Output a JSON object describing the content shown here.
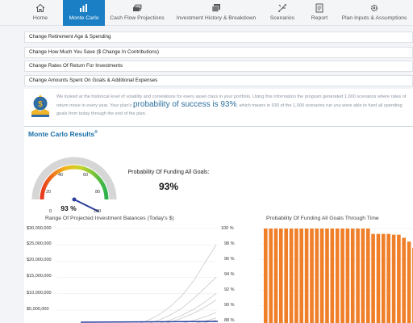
{
  "nav": {
    "items": [
      {
        "label": "Home",
        "icon": "home-icon"
      },
      {
        "label": "Monte Carlo",
        "icon": "bar-chart-icon",
        "active": true
      },
      {
        "label": "Cash Flow Projections",
        "icon": "cash-stack-icon"
      },
      {
        "label": "Investment History & Breakdown",
        "icon": "layers-icon"
      },
      {
        "label": "Scenarios",
        "icon": "scenarios-icon"
      },
      {
        "label": "Report",
        "icon": "report-icon"
      },
      {
        "label": "Plan Inputs & Assumptions",
        "icon": "gear-icon"
      }
    ]
  },
  "accordion": [
    "Change Retirement Age & Spending",
    "Change How Much You Save ($ Change In Contributions)",
    "Change Rates Of Return For Investments",
    "Change Amounts Spent On Goals & Additional Expenses"
  ],
  "intro": {
    "text_before": "We looked at the historical level of volatility and correlations for every asset class in your portfolio. Using this information the program generated 1,000 scenarios where rates of return move in every year. Your plan's ",
    "probability_phrase": "probability of success is 93%",
    "text_after": ", which means in 930 of the 1,000 scenarios run you were able to fund all spending goals from today through the end of the plan."
  },
  "results": {
    "title": "Monte Carlo Results",
    "registered": "®",
    "gauge": {
      "value": 93,
      "value_label": "93 %",
      "ticks": [
        "0",
        "20",
        "40",
        "60",
        "80",
        "100"
      ]
    },
    "funding_label": "Probability Of Funding All Goals:",
    "funding_value": "93%"
  },
  "colors": {
    "accent": "#1a7fc4",
    "bar": "#f07f2a",
    "gauge_needle": "#2a3f9e"
  },
  "chart_data": [
    {
      "type": "line",
      "title": "Range Of Projected Investment Balances (Today's $)",
      "y_tick_labels": [
        "$30,000,000",
        "$25,000,000",
        "$20,000,000",
        "$15,000,000",
        "$10,000,000",
        "$5,000,000"
      ],
      "ylim": [
        0,
        30000000
      ],
      "series": [
        {
          "values": [
            1200000,
            1400000,
            1700000,
            2100000,
            2600000,
            3400000,
            4600000,
            6200000,
            8500000,
            11500000,
            15500000,
            20500000,
            25500000
          ]
        },
        {
          "values": [
            1200000,
            1350000,
            1550000,
            1850000,
            2200000,
            2800000,
            3600000,
            4700000,
            6100000,
            8000000,
            10600000,
            13500000,
            16500000
          ]
        },
        {
          "values": [
            1200000,
            1300000,
            1450000,
            1650000,
            1900000,
            2250000,
            2700000,
            3300000,
            4100000,
            5200000,
            6500000,
            8200000,
            10200000
          ]
        },
        {
          "values": [
            1200000,
            1280000,
            1380000,
            1500000,
            1680000,
            1900000,
            2200000,
            2600000,
            3100000,
            3700000,
            4500000,
            5500000,
            6700000
          ]
        },
        {
          "values": [
            1200000,
            1250000,
            1320000,
            1400000,
            1520000,
            1680000,
            1880000,
            2150000,
            2450000,
            2850000,
            3300000,
            3900000,
            4600000
          ]
        },
        {
          "values": [
            1200000,
            1230000,
            1280000,
            1340000,
            1420000,
            1520000,
            1650000,
            1800000,
            2000000,
            2250000,
            2550000,
            2900000,
            3300000
          ]
        },
        {
          "values": [
            1200000,
            1210000,
            1240000,
            1280000,
            1330000,
            1390000,
            1470000,
            1560000,
            1680000,
            1820000,
            2000000,
            2200000,
            2450000
          ]
        },
        {
          "values": [
            1200000,
            1190000,
            1200000,
            1220000,
            1240000,
            1270000,
            1300000,
            1350000,
            1400000,
            1460000,
            1540000,
            1620000,
            1720000
          ]
        },
        {
          "values": [
            1200000,
            1170000,
            1150000,
            1140000,
            1130000,
            1120000,
            1110000,
            1110000,
            1120000,
            1130000,
            1150000,
            1170000,
            1200000
          ]
        },
        {
          "values": [
            1200000,
            1150000,
            1100000,
            1050000,
            1000000,
            960000,
            920000,
            890000,
            860000,
            840000,
            820000,
            800000,
            790000
          ]
        },
        {
          "values": [
            1200000,
            1260000,
            1340000,
            1440000,
            1580000,
            1760000,
            1980000,
            2250000,
            2600000,
            3050000,
            3600000,
            4300000,
            5200000
          ]
        },
        {
          "values": [
            1200000,
            1320000,
            1480000,
            1700000,
            2000000,
            2400000,
            2950000,
            3700000,
            4700000,
            6000000,
            7600000,
            9600000,
            12000000
          ]
        }
      ]
    },
    {
      "type": "bar",
      "title": "Probability Of Funding All Goals Through Time",
      "y_tick_labels": [
        "100 %",
        "98 %",
        "96 %",
        "94 %",
        "92 %",
        "90 %",
        "88 %"
      ],
      "ylim": [
        88,
        100
      ],
      "values": [
        100,
        100,
        100,
        100,
        100,
        100,
        100,
        100,
        100,
        100,
        100,
        100,
        100,
        100,
        100,
        100,
        100,
        100,
        100,
        100,
        100,
        99.3,
        99.3,
        99.3,
        99.3,
        99.2,
        99.2,
        98.8,
        98.3,
        97.5,
        97.1,
        96.3,
        96.2
      ]
    }
  ]
}
